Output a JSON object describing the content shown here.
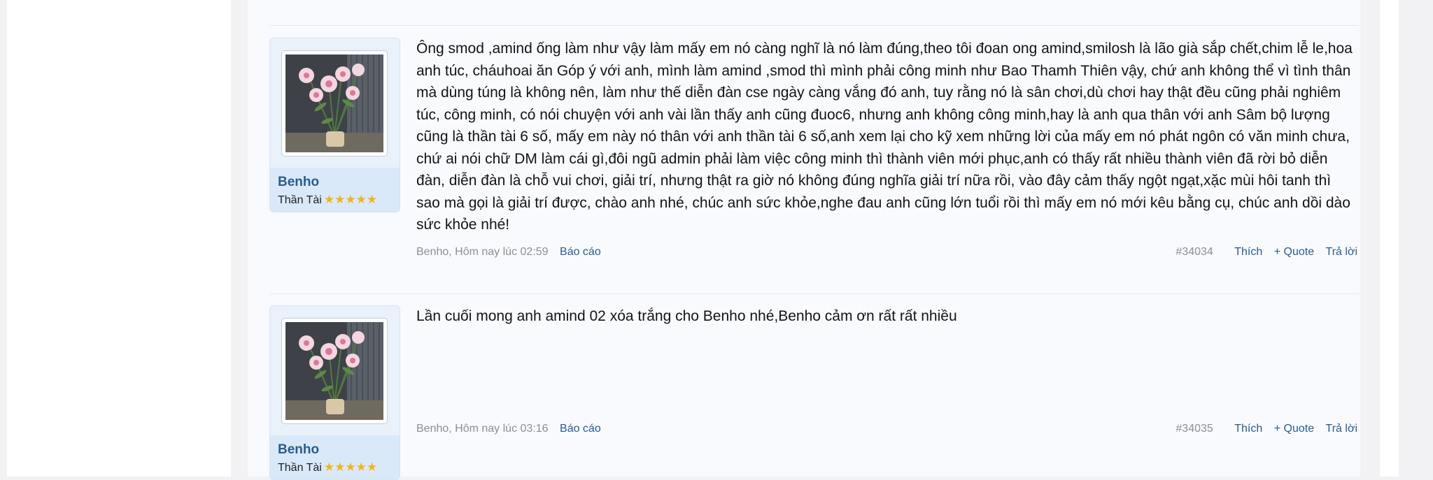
{
  "posts": [
    {
      "username": "Benho",
      "user_title": "Thần Tài",
      "rating_stars": "★★★★★",
      "message": "Ông smod ,amind ống làm như vậy làm mấy em nó càng nghĩ là nó làm đúng,theo tôi đoan ong amind,smilosh là lão già sắp chết,chim lễ le,hoa anh túc, cháuhoai ăn Góp ý với anh, mình làm amind ,smod thì mình phải công minh như Bao Thamh Thiên vậy, chứ anh không thể vì tình thân mà dùng túng là không nên, làm như thế diễn đàn cse ngày càng vắng đó anh, tuy rằng nó là sân chơi,dù chơi hay thật đều cũng phải nghiêm túc, công minh, có nói chuyện với anh vài lần thấy anh cũng đuoc6, nhưng anh không công minh,hay là anh qua thân với anh Sâm bộ lượng cũng là thần tài 6 số, mấy em này nó thân với anh thần tài 6 số,anh xem lại cho kỹ xem những lời của mấy em nó phát ngôn có văn minh chưa, chứ ai nói chữ DM làm cái gì,đôi ngũ admin phải làm việc công minh thì thành viên mới phục,anh có thấy rất nhiều thành viên đã rời bỏ diễn đàn, diễn đàn là chỗ vui chơi, giải trí, nhưng thật ra giờ nó không đúng nghĩa giải trí nữa rồi, vào đây cảm thấy ngột ngạt,xặc mùi hôi tanh thì sao mà gọi là giải trí được, chào anh nhé, chúc anh sức khỏe,nghe đau anh cũng lớn tuổi rồi thì mấy em nó mới kêu bằng cụ, chúc anh dồi dào sức khỏe nhé!",
      "author_date": "Benho, Hôm nay lúc 02:59",
      "report": "Báo cáo",
      "post_number": "#34034",
      "like": "Thích",
      "quote": "+ Quote",
      "reply": "Trả lời"
    },
    {
      "username": "Benho",
      "user_title": "Thần Tài",
      "rating_stars": "★★★★★",
      "message": "Lần cuối mong anh amind 02 xóa trắng cho Benho nhé,Benho cảm ơn rất rất nhiều",
      "author_date": "Benho, Hôm nay lúc 03:16",
      "report": "Báo cáo",
      "post_number": "#34035",
      "like": "Thích",
      "quote": "+ Quote",
      "reply": "Trả lời"
    }
  ],
  "colors": {
    "link": "#2b5c8a",
    "muted": "#8a8f98",
    "star": "#f2b418",
    "card_bg": "#e9f1fb"
  },
  "icons": {
    "avatar": "lily-flowers-vase-photo",
    "rating": "star-icon"
  }
}
